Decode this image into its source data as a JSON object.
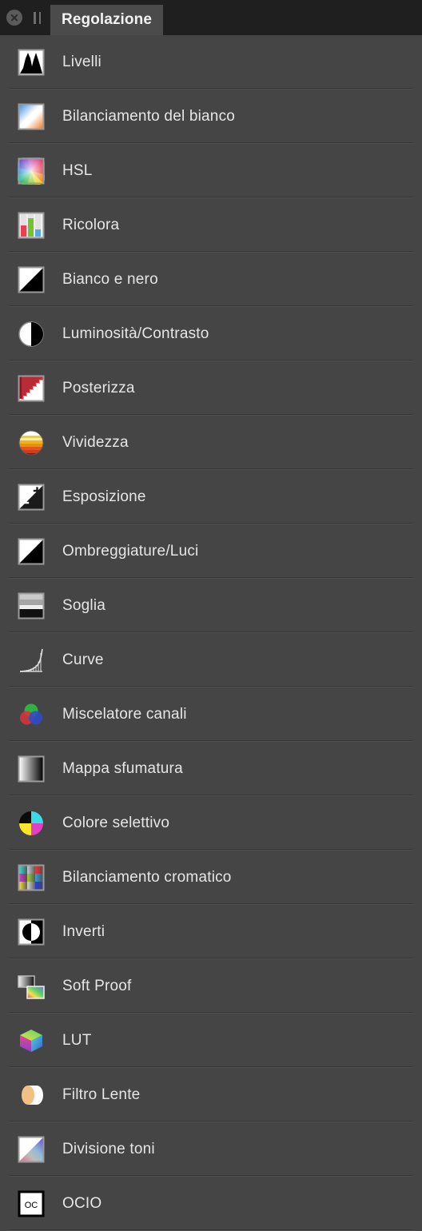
{
  "window": {
    "close_icon": "close-icon",
    "grip_icon": "drag-grip-icon",
    "tab_label": "Regolazione"
  },
  "colors": {
    "panel_bg": "#454545",
    "titlebar_bg": "#1f1f1f",
    "tab_bg": "#4b4b4b",
    "separator": "#373737",
    "label_text": "#e6e6e6"
  },
  "list": {
    "items": [
      {
        "label": "Livelli",
        "icon": "histogram-icon"
      },
      {
        "label": "Bilanciamento del bianco",
        "icon": "white-balance-icon"
      },
      {
        "label": "HSL",
        "icon": "color-wheel-icon"
      },
      {
        "label": "Ricolora",
        "icon": "recolor-bars-icon"
      },
      {
        "label": "Bianco e nero",
        "icon": "black-white-diagonal-icon"
      },
      {
        "label": "Luminosità/Contrasto",
        "icon": "brightness-contrast-circle-icon"
      },
      {
        "label": "Posterizza",
        "icon": "posterize-steps-icon"
      },
      {
        "label": "Vividezza",
        "icon": "vibrance-sphere-icon"
      },
      {
        "label": "Esposizione",
        "icon": "exposure-plus-minus-icon"
      },
      {
        "label": "Ombreggiature/Luci",
        "icon": "shadows-highlights-icon"
      },
      {
        "label": "Soglia",
        "icon": "threshold-bands-icon"
      },
      {
        "label": "Curve",
        "icon": "curves-icon"
      },
      {
        "label": "Miscelatore canali",
        "icon": "channel-mixer-venn-icon"
      },
      {
        "label": "Mappa sfumatura",
        "icon": "gradient-map-icon"
      },
      {
        "label": "Colore selettivo",
        "icon": "selective-color-pie-icon"
      },
      {
        "label": "Bilanciamento cromatico",
        "icon": "color-balance-grid-icon"
      },
      {
        "label": "Inverti",
        "icon": "invert-icon"
      },
      {
        "label": "Soft Proof",
        "icon": "soft-proof-icon"
      },
      {
        "label": "LUT",
        "icon": "lut-cube-icon"
      },
      {
        "label": "Filtro Lente",
        "icon": "lens-filter-icon"
      },
      {
        "label": "Divisione toni",
        "icon": "split-toning-icon"
      },
      {
        "label": "OCIO",
        "icon": "ocio-icon"
      }
    ]
  }
}
